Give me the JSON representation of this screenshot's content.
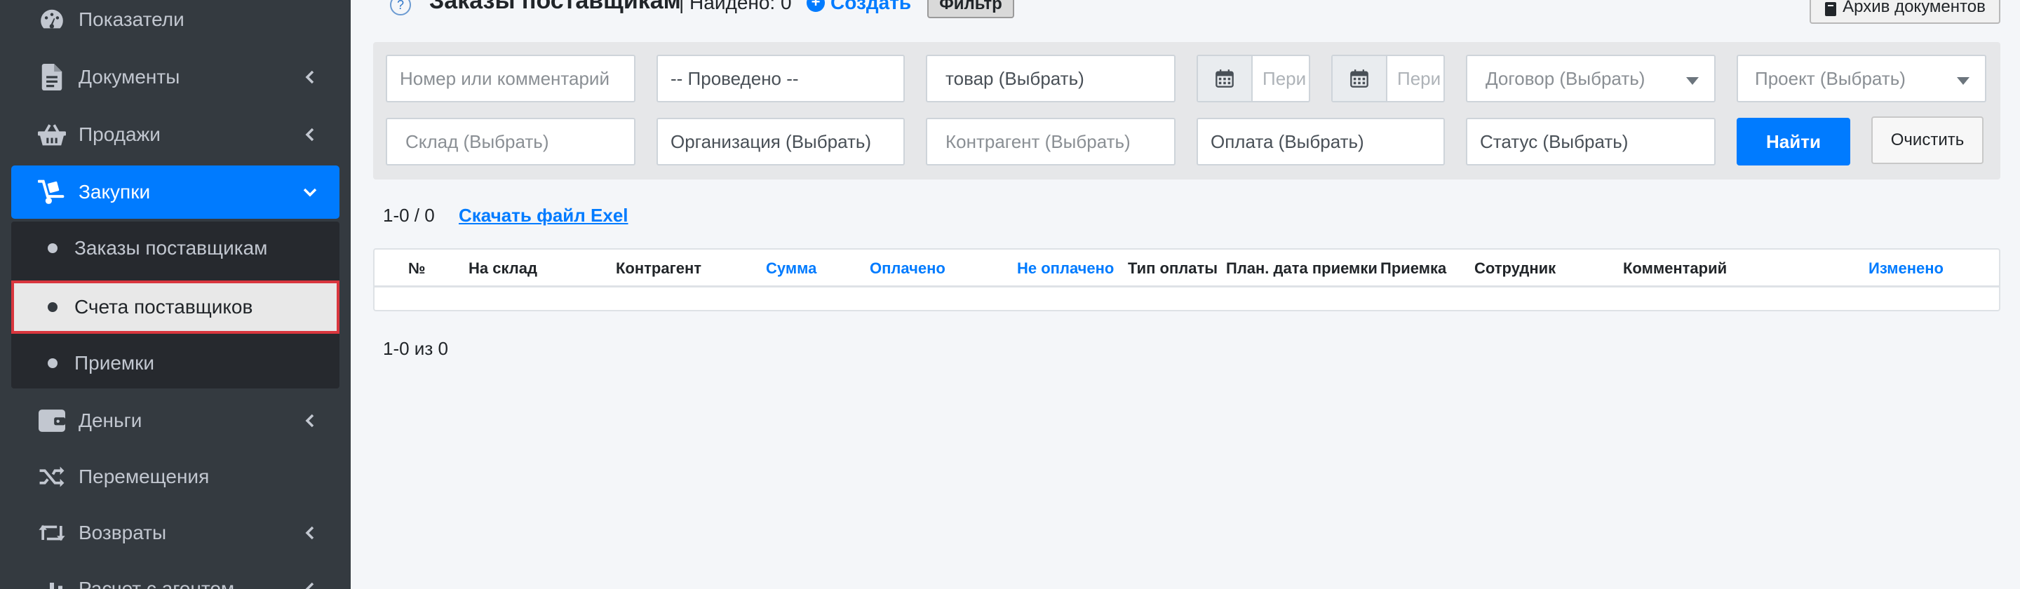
{
  "sidebar": {
    "items": [
      {
        "label": "Показатели",
        "icon": "dashboard-icon",
        "has_chevron": false
      },
      {
        "label": "Документы",
        "icon": "document-icon",
        "has_chevron": true
      },
      {
        "label": "Продажи",
        "icon": "basket-icon",
        "has_chevron": true
      },
      {
        "label": "Закупки",
        "icon": "dolly-icon",
        "has_chevron": true,
        "active": true
      },
      {
        "label": "Деньги",
        "icon": "wallet-icon",
        "has_chevron": true
      },
      {
        "label": "Перемещения",
        "icon": "shuffle-icon",
        "has_chevron": false
      },
      {
        "label": "Возвраты",
        "icon": "retweet-icon",
        "has_chevron": true
      },
      {
        "label": "Расчет с агентом",
        "icon": "chart-icon",
        "has_chevron": true
      }
    ],
    "submenu": [
      {
        "label": "Заказы поставщикам"
      },
      {
        "label": "Счета поставщиков",
        "selected": true
      },
      {
        "label": "Приемки"
      }
    ]
  },
  "header": {
    "help": "?",
    "title": "Заказы поставщикам",
    "found": "| Найдено: 0",
    "create": "Создать",
    "filter": "Фильтр",
    "archive": "Архив документов"
  },
  "filters": {
    "number_or_comment": "Номер или комментарий",
    "posted": "-- Проведено --",
    "product": "товар (Выбрать)",
    "period_from": "Пери",
    "period_to": "Пери",
    "contract": "Договор (Выбрать)",
    "project": "Проект (Выбрать)",
    "warehouse": "Склад (Выбрать)",
    "organization": "Организация (Выбрать)",
    "counterparty": "Контрагент (Выбрать)",
    "payment": "Оплата (Выбрать)",
    "status": "Статус (Выбрать)",
    "find": "Найти",
    "clear": "Очистить"
  },
  "results": {
    "count_top": "1-0 / 0",
    "download": "Скачать файл Exel",
    "count_bottom": "1-0 из 0"
  },
  "table": {
    "columns": [
      {
        "label": "№",
        "sortable": false
      },
      {
        "label": "На склад",
        "sortable": false
      },
      {
        "label": "Контрагент",
        "sortable": false
      },
      {
        "label": "Сумма",
        "sortable": true
      },
      {
        "label": "Оплачено",
        "sortable": true
      },
      {
        "label": "Не оплачено",
        "sortable": true
      },
      {
        "label": "Тип оплаты",
        "sortable": false
      },
      {
        "label": "План. дата приемки",
        "sortable": false
      },
      {
        "label": "Приемка",
        "sortable": false
      },
      {
        "label": "Сотрудник",
        "sortable": false
      },
      {
        "label": "Комментарий",
        "sortable": false
      },
      {
        "label": "Изменено",
        "sortable": true
      }
    ]
  },
  "colors": {
    "sidebar_bg": "#343a40",
    "accent": "#007bff",
    "selection_border": "#d9363e"
  }
}
